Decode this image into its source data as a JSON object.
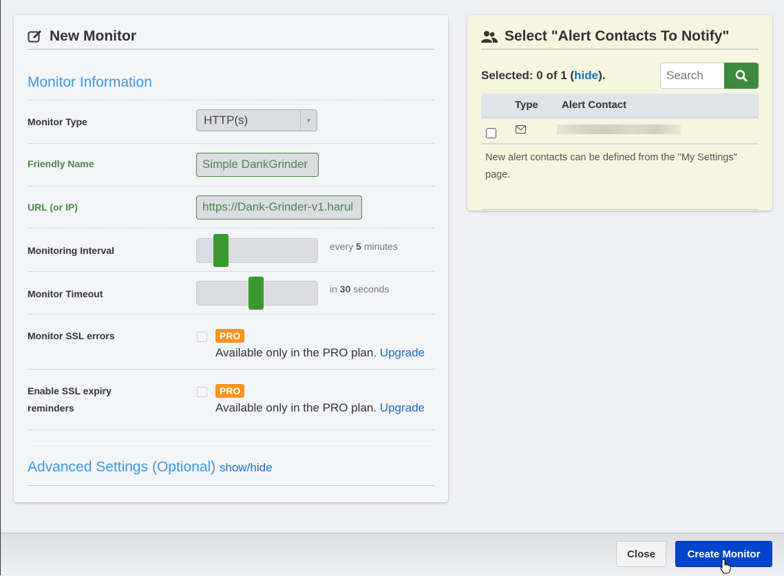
{
  "new_monitor": {
    "title": "New Monitor",
    "section_title": "Monitor Information",
    "fields": {
      "monitor_type": {
        "label": "Monitor Type",
        "value": "HTTP(s)"
      },
      "friendly_name": {
        "label": "Friendly Name",
        "value": "Simple DankGrinder"
      },
      "url": {
        "label": "URL (or IP)",
        "value": "https://Dank-Grinder-v1.harul"
      },
      "interval": {
        "label": "Monitoring Interval",
        "prefix": "every",
        "value": "5",
        "suffix": "minutes",
        "slider_fraction": 0.2
      },
      "timeout": {
        "label": "Monitor Timeout",
        "prefix": "in",
        "value": "30",
        "suffix": "seconds",
        "slider_fraction": 0.49
      },
      "ssl_errors": {
        "label": "Monitor SSL errors",
        "badge": "PRO",
        "note": "Available only in the PRO plan.",
        "link": "Upgrade",
        "checked": false
      },
      "ssl_expiry": {
        "label_line1": "Enable SSL expiry",
        "label_line2": "reminders",
        "badge": "PRO",
        "note": "Available only in the PRO plan.",
        "link": "Upgrade",
        "checked": false
      }
    },
    "advanced": {
      "title": "Advanced Settings (Optional)",
      "toggle": "show/hide"
    }
  },
  "alert_contacts": {
    "title": "Select \"Alert Contacts To Notify\"",
    "selected_prefix": "Selected: 0 of 1 (",
    "hide_link": "hide",
    "selected_suffix": ").",
    "search_placeholder": "Search",
    "columns": [
      "Type",
      "Alert Contact"
    ],
    "rows": [
      {
        "type_icon": "envelope-icon",
        "contact": "",
        "checked": false
      }
    ],
    "note": "New alert contacts can be defined from the \"My Settings\" page."
  },
  "footer": {
    "close_label": "Close",
    "create_label": "Create Monitor"
  },
  "colors": {
    "accent_blue": "#3a9ae8",
    "link": "#1a6fc4",
    "valid_green": "#468847",
    "slider_green": "#3a9a2e",
    "pro_orange": "#f7941d",
    "primary_button": "#0044cc"
  }
}
